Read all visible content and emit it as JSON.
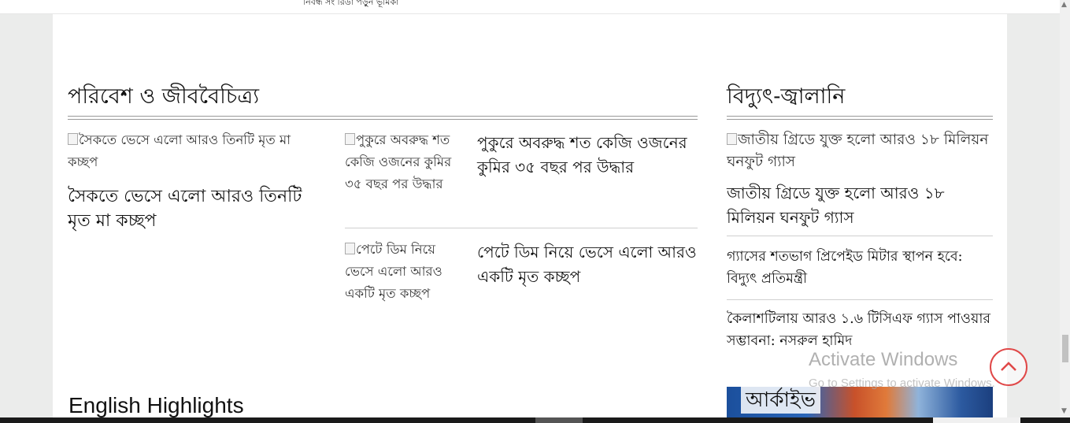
{
  "top_bar": {
    "text": "নিবন্ধ সং রিডা পড়ুন ভূমিকা"
  },
  "environment": {
    "title": "পরিবেশ ও জীববৈচিত্র্য",
    "lead": {
      "image_alt": "সৈকতে ভেসে এলো আরও তিনটি মৃত মা কচ্ছপ",
      "headline": "সৈকতে ভেসে এলো আরও তিনটি মৃত মা কচ্ছপ"
    },
    "items": [
      {
        "image_alt": "পুকুরে অবরুদ্ধ শত কেজি ওজনের কুমির ৩৫ বছর পর উদ্ধার",
        "headline": "পুকুরে অবরুদ্ধ শত কেজি ওজনের কুমির ৩৫ বছর পর উদ্ধার"
      },
      {
        "image_alt": "পেটে ডিম নিয়ে ভেসে এলো আরও একটি মৃত কচ্ছপ",
        "headline": "পেটে ডিম নিয়ে ভেসে এলো আরও একটি মৃত কচ্ছপ"
      }
    ]
  },
  "energy": {
    "title": "বিদ্যুৎ-জ্বালানি",
    "lead": {
      "image_alt": "জাতীয় গ্রিডে যুক্ত হলো আরও ১৮ মিলিয়ন ঘনফুট গ্যাস",
      "headline": "জাতীয় গ্রিডে যুক্ত হলো আরও ১৮ মিলিয়ন ঘনফুট গ্যাস"
    },
    "items": [
      {
        "headline": "গ্যাসের শতভাগ প্রিপেইড মিটার স্থাপন হবে: বিদ্যুৎ প্রতিমন্ত্রী"
      },
      {
        "headline": "কৈলাশটিলায় আরও ১.৬ টিসিএফ গ্যাস পাওয়ার সম্ভাবনা: নসরুল হামিদ"
      }
    ]
  },
  "english_highlights": {
    "title": "English Highlights"
  },
  "archive": {
    "label": "আর্কাইভ"
  },
  "watermark": {
    "title": "Activate Windows",
    "subtitle": "Go to Settings to activate Windows."
  },
  "icons": {
    "scroll_top": "chevron-up-icon",
    "scroll_up": "scroll-up-arrow-icon",
    "scroll_down": "scroll-down-arrow-icon"
  },
  "colors": {
    "scroll_top_ring": "#e04848",
    "page_background": "#ebeceb",
    "content_background": "#ffffff"
  }
}
